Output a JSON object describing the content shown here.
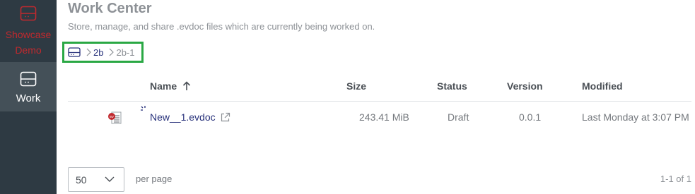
{
  "sidebar": {
    "items": [
      {
        "label": "Showcase Demo",
        "icon": "drive-icon",
        "color": "#c0292e"
      },
      {
        "label": "Work",
        "icon": "drive-icon",
        "active": true
      }
    ]
  },
  "header": {
    "title": "Work Center",
    "subtitle": "Store, manage, and share .evdoc files which are currently being worked on."
  },
  "breadcrumb": {
    "root_icon": "drive-icon",
    "items": [
      "2b",
      "2b-1"
    ]
  },
  "table": {
    "columns": [
      "Name",
      "Size",
      "Status",
      "Version",
      "Modified"
    ],
    "sort": {
      "column": "Name",
      "direction": "ascending"
    },
    "rows": [
      {
        "name": "New__1.evdoc",
        "size": "243.41 MiB",
        "status": "Draft",
        "version": "0.0.1",
        "modified": "Last Monday at 3:07 PM"
      }
    ]
  },
  "footer": {
    "per_page_value": "50",
    "per_page_label": "per page",
    "range": "1-1 of 1"
  },
  "colors": {
    "sidebar": "#2e3a43",
    "sidebar_active": "#445058",
    "brand_red": "#c0292e",
    "link": "#26307a",
    "highlight": "#2aa844"
  }
}
